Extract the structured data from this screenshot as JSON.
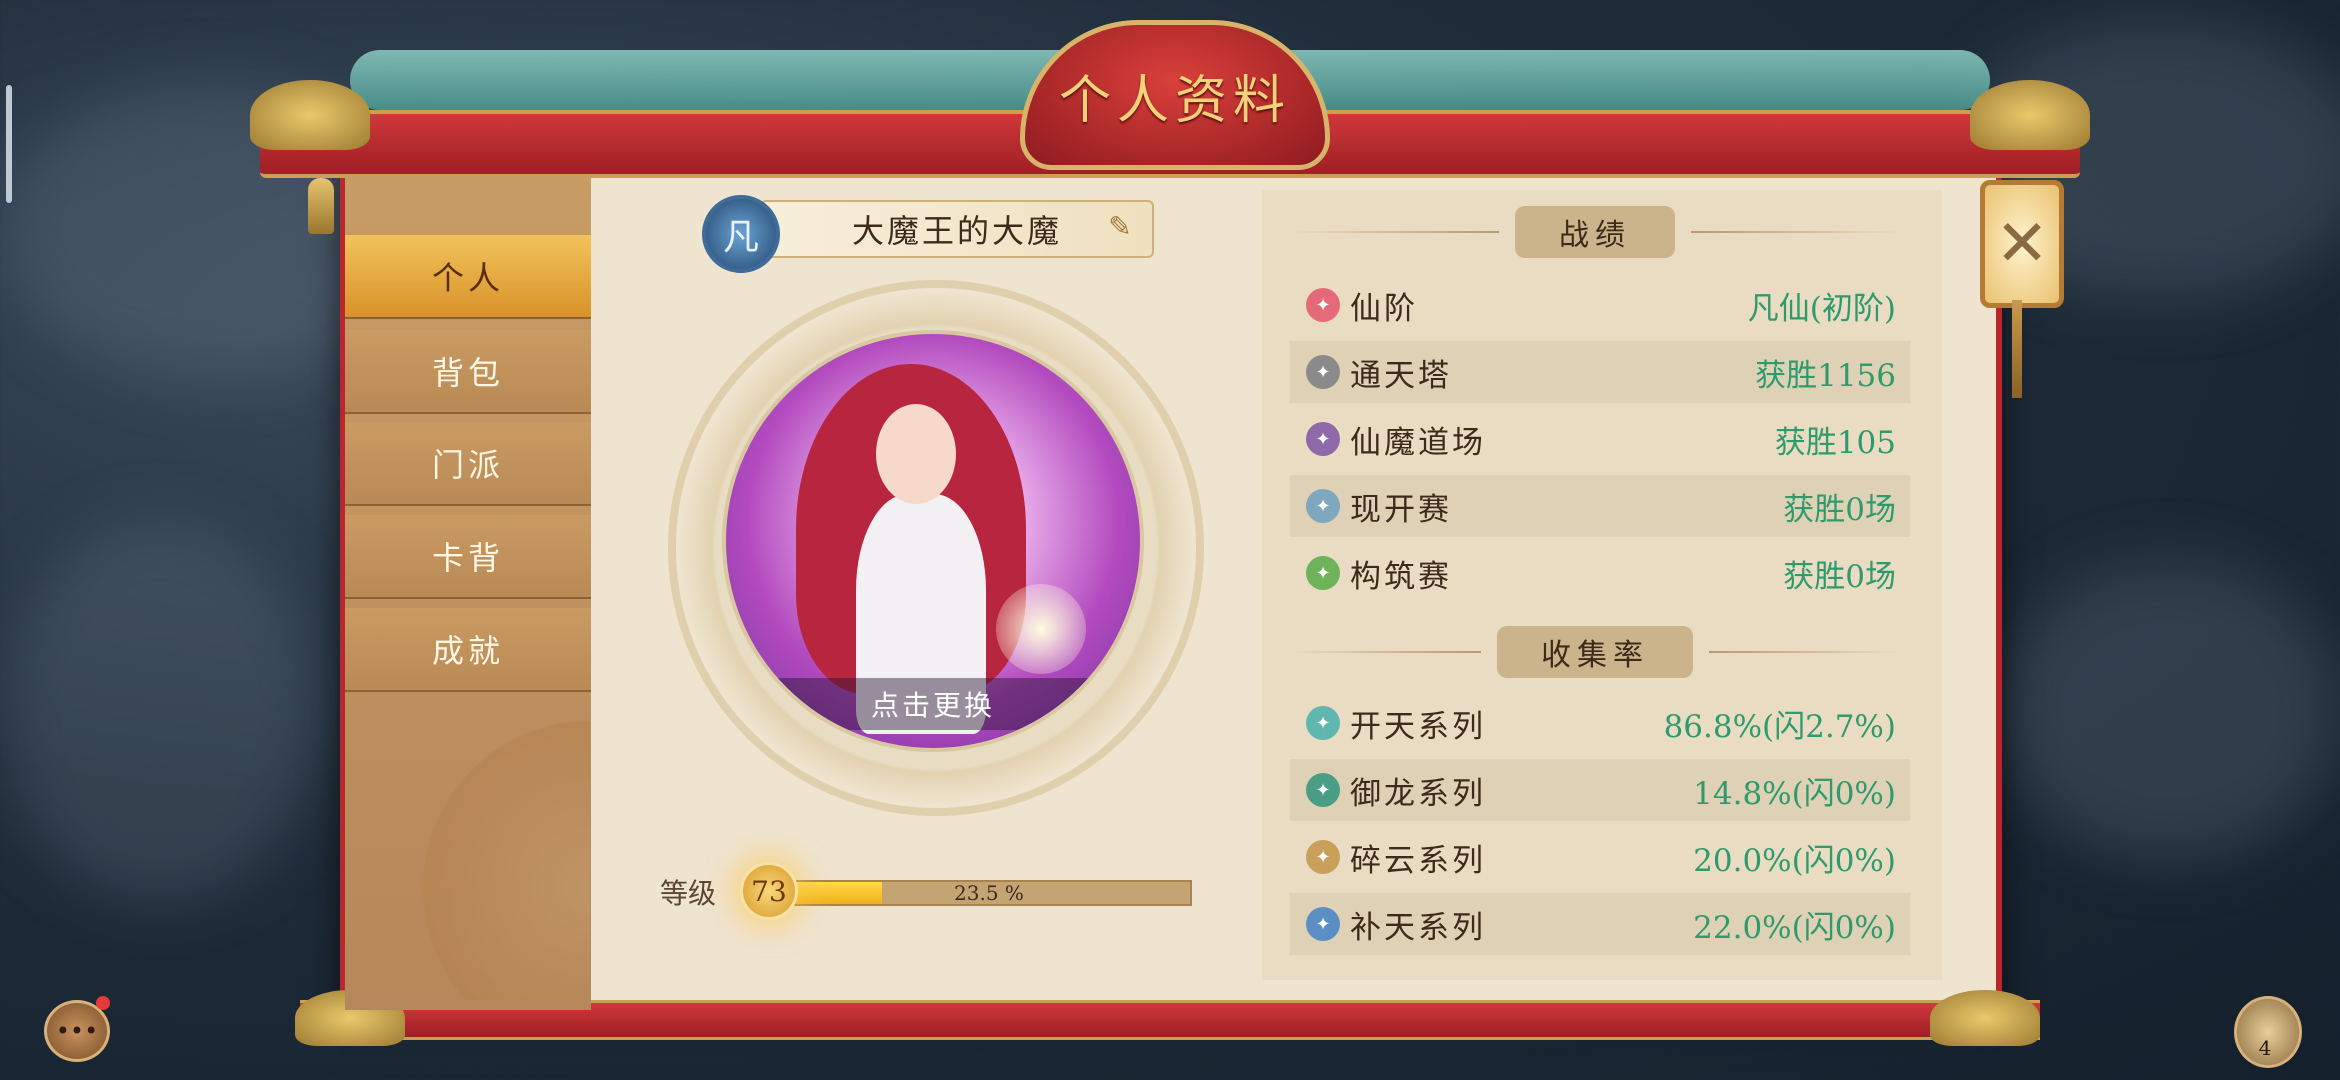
{
  "window": {
    "title": "个人资料"
  },
  "nav": {
    "items": [
      {
        "label": "个人",
        "active": true
      },
      {
        "label": "背包",
        "active": false
      },
      {
        "label": "门派",
        "active": false
      },
      {
        "label": "卡背",
        "active": false
      },
      {
        "label": "成就",
        "active": false
      }
    ]
  },
  "profile": {
    "rank_glyph": "凡",
    "name": "大魔王的大魔",
    "change_avatar_label": "点击更换",
    "level_label": "等级",
    "level": "73",
    "progress_text": "23.5 %",
    "progress": 0.235
  },
  "record": {
    "title": "战绩",
    "rows": [
      {
        "icon": "star-icon",
        "label": "仙阶",
        "value": "凡仙(初阶)",
        "color": "#e46a7a"
      },
      {
        "icon": "tower-icon",
        "label": "通天塔",
        "value": "获胜1156",
        "color": "#8a8a8a"
      },
      {
        "icon": "demon-icon",
        "label": "仙魔道场",
        "value": "获胜105",
        "color": "#8f6aa8"
      },
      {
        "icon": "tournament-icon",
        "label": "现开赛",
        "value": "获胜0场",
        "color": "#7fa7bd"
      },
      {
        "icon": "build-icon",
        "label": "构筑赛",
        "value": "获胜0场",
        "color": "#6eb35a"
      }
    ]
  },
  "collection": {
    "title": "收集率",
    "rows": [
      {
        "icon": "kaitian-icon",
        "label": "开天系列",
        "value": "86.8%(闪2.7%)",
        "color": "#5fb7b0"
      },
      {
        "icon": "dragon-icon",
        "label": "御龙系列",
        "value": "14.8%(闪0%)",
        "color": "#4a9e86"
      },
      {
        "icon": "cloud-icon",
        "label": "碎云系列",
        "value": "20.0%(闪0%)",
        "color": "#c8a05a"
      },
      {
        "icon": "sky-icon",
        "label": "补天系列",
        "value": "22.0%(闪0%)",
        "color": "#5b8fc4"
      }
    ]
  },
  "controls": {
    "close_glyph": "✕",
    "bag_count": "4"
  }
}
